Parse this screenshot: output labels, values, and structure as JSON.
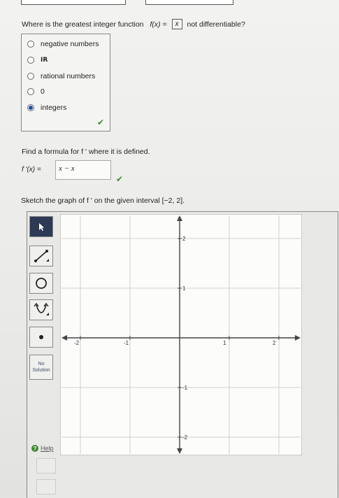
{
  "question1": {
    "prefix": "Where is the greatest integer function",
    "fx": "f(x) =",
    "floor_var": "x",
    "suffix": "not differentiable?",
    "options": [
      {
        "label": "negative numbers",
        "selected": false
      },
      {
        "label": "IR",
        "selected": false
      },
      {
        "label": "rational numbers",
        "selected": false
      },
      {
        "label": "0",
        "selected": false
      },
      {
        "label": "integers",
        "selected": true
      }
    ]
  },
  "question2": {
    "prompt": "Find a formula for f ' where it is defined.",
    "label": "f '(x) =",
    "answer": "x − x"
  },
  "question3": {
    "prompt": "Sketch the graph of f ' on the given interval [−2, 2]."
  },
  "tools": {
    "no_solution_line1": "No",
    "no_solution_line2": "Solution",
    "help_label": "Help"
  },
  "graph": {
    "x_ticks": [
      {
        "value": -2,
        "label": "-2"
      },
      {
        "value": -1,
        "label": "-1"
      },
      {
        "value": 1,
        "label": "1"
      },
      {
        "value": 2,
        "label": "2"
      }
    ],
    "y_ticks": [
      {
        "value": 2,
        "label": "2"
      },
      {
        "value": 1,
        "label": "1"
      },
      {
        "value": -1,
        "label": "-1"
      },
      {
        "value": -2,
        "label": "-2"
      }
    ],
    "xlim": [
      -2.4,
      2.4
    ],
    "ylim": [
      -2.4,
      2.4
    ]
  },
  "colors": {
    "check": "#3c8a2a",
    "selected_radio": "#1b4fa8",
    "active_tool": "#2c3a55"
  }
}
